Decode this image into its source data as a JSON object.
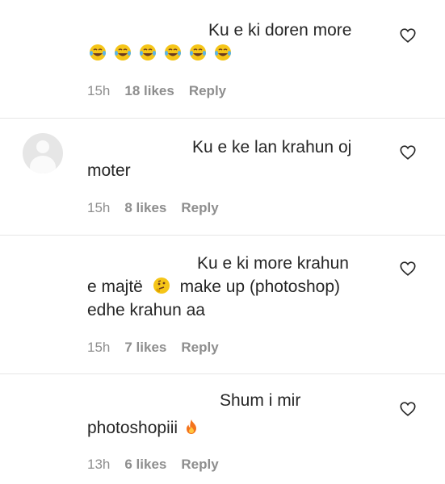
{
  "comments": [
    {
      "lines": [
        "Ku e ki doren more"
      ],
      "emojis": [
        "laughing-tears",
        "laughing-tears",
        "laughing-tears",
        "laughing-tears",
        "laughing-tears",
        "laughing-tears"
      ],
      "time": "15h",
      "likes": "18 likes",
      "reply": "Reply"
    },
    {
      "lines": [
        "Ku e ke lan krahun oj",
        "moter"
      ],
      "time": "15h",
      "likes": "8 likes",
      "reply": "Reply"
    },
    {
      "lines": [
        "Ku e ki more krahun",
        "e majtë",
        "make up (photoshop)",
        "edhe krahun aa"
      ],
      "emoji": "thinking-face",
      "time": "15h",
      "likes": "7 likes",
      "reply": "Reply"
    },
    {
      "lines": [
        "Shum i mir",
        "photoshopiii"
      ],
      "emoji": "fire",
      "time": "13h",
      "likes": "6 likes",
      "reply": "Reply"
    }
  ],
  "colors": {
    "text": "#262626",
    "meta": "#8e8e8e",
    "emoji": "#f5c518"
  }
}
